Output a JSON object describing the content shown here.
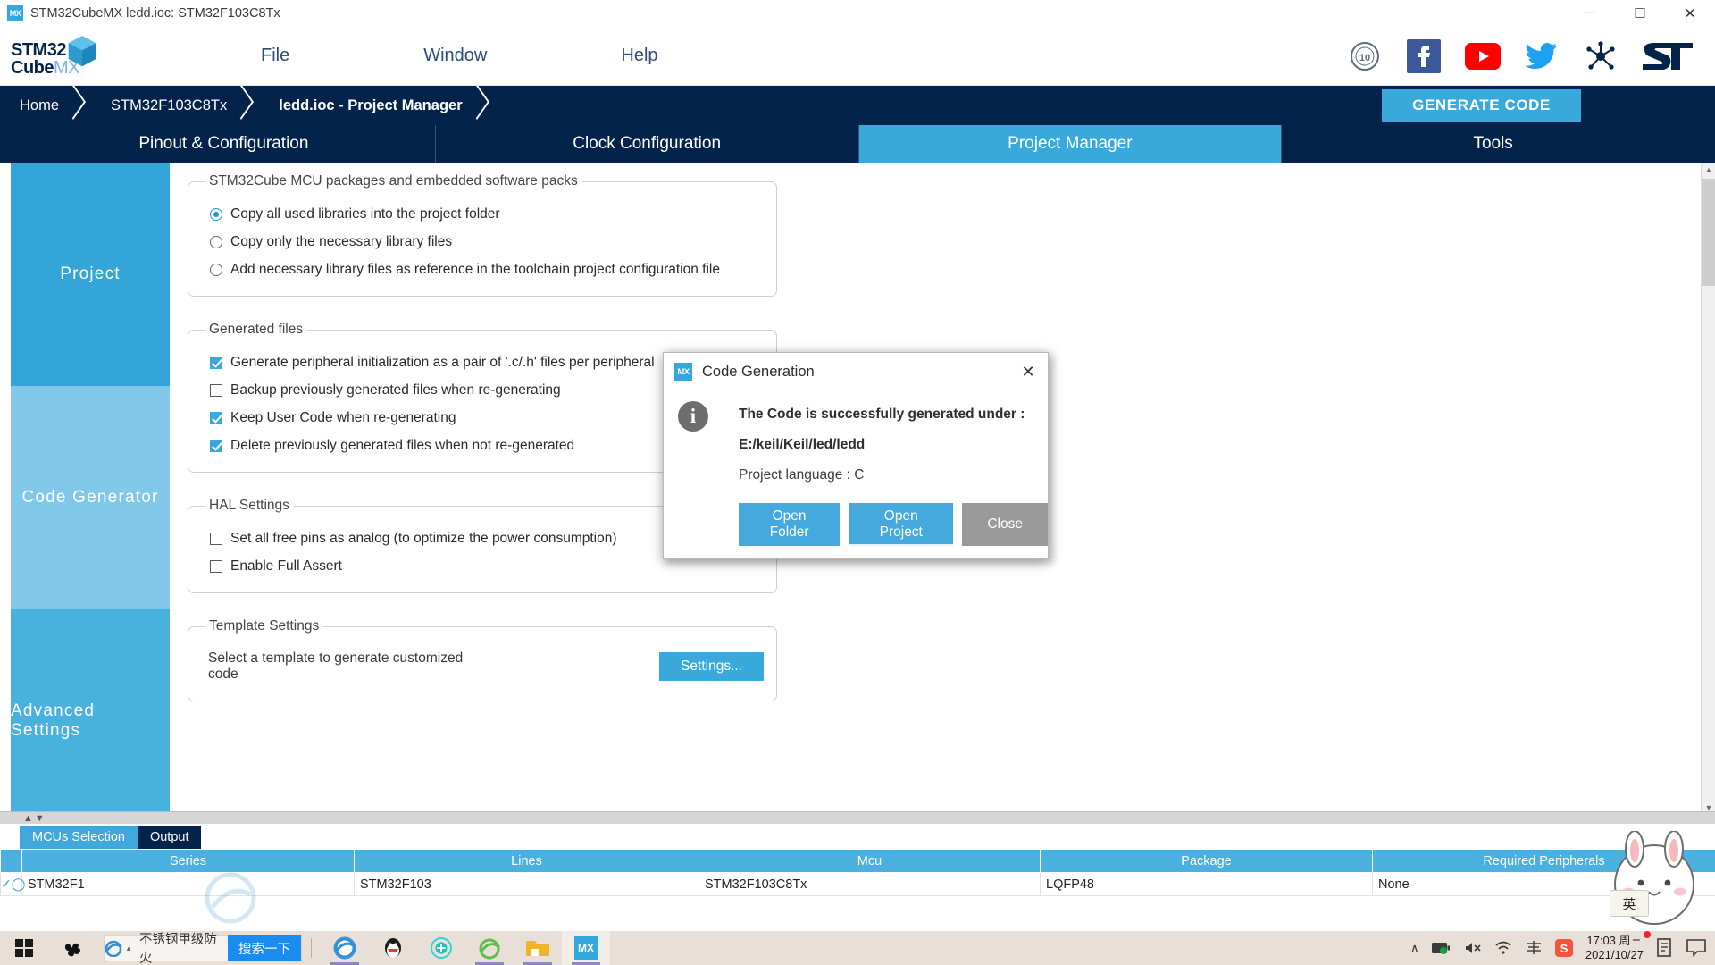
{
  "window": {
    "title": "STM32CubeMX ledd.ioc: STM32F103C8Tx",
    "app_icon": "MX",
    "minimize": "─",
    "maximize": "☐",
    "close": "✕"
  },
  "header": {
    "logo_line1": "STM32",
    "logo_line2": "Cube",
    "logo_line2_suffix": "MX",
    "menu": [
      {
        "label": "File"
      },
      {
        "label": "Window"
      },
      {
        "label": "Help"
      }
    ],
    "icons": [
      {
        "name": "ten-years-badge-icon",
        "label": "10"
      },
      {
        "name": "facebook-icon",
        "label": "f"
      },
      {
        "name": "youtube-icon",
        "label": "▶"
      },
      {
        "name": "twitter-icon",
        "label": "🐦"
      },
      {
        "name": "st-community-icon",
        "label": "✳"
      },
      {
        "name": "st-logo-icon",
        "label": "ST"
      }
    ]
  },
  "breadcrumb": {
    "items": [
      {
        "label": "Home",
        "bold": false
      },
      {
        "label": "STM32F103C8Tx",
        "bold": false
      },
      {
        "label": "ledd.ioc - Project Manager",
        "bold": true
      }
    ],
    "generate_code_label": "GENERATE CODE"
  },
  "main_tabs": [
    {
      "label": "Pinout & Configuration",
      "active": false
    },
    {
      "label": "Clock Configuration",
      "active": false
    },
    {
      "label": "Project Manager",
      "active": true
    },
    {
      "label": "Tools",
      "active": false
    }
  ],
  "sidebar": {
    "items": [
      {
        "label": "Project",
        "state": "normal"
      },
      {
        "label": "Code Generator",
        "state": "selected"
      },
      {
        "label": "Advanced Settings",
        "state": "normal"
      }
    ]
  },
  "panel": {
    "packages_group": {
      "legend": "STM32Cube MCU packages and embedded software packs",
      "options": [
        {
          "label": "Copy all used libraries into the project folder",
          "checked": true
        },
        {
          "label": "Copy only the necessary library files",
          "checked": false
        },
        {
          "label": "Add necessary library files as reference in the toolchain project configuration file",
          "checked": false
        }
      ]
    },
    "generated_files_group": {
      "legend": "Generated files",
      "options": [
        {
          "label": "Generate peripheral initialization as a pair of '.c/.h' files per peripheral",
          "checked": true
        },
        {
          "label": "Backup previously generated files when re-generating",
          "checked": false
        },
        {
          "label": "Keep User Code when re-generating",
          "checked": true
        },
        {
          "label": "Delete previously generated files when not re-generated",
          "checked": true
        }
      ]
    },
    "hal_settings_group": {
      "legend": "HAL Settings",
      "options": [
        {
          "label": "Set all free pins as analog (to optimize the power consumption)",
          "checked": false
        },
        {
          "label": "Enable Full Assert",
          "checked": false
        }
      ]
    },
    "template_settings_group": {
      "legend": "Template Settings",
      "description": "Select a template to generate customized code",
      "settings_button": "Settings..."
    }
  },
  "dialog": {
    "icon": "MX",
    "title": "Code Generation",
    "close_label": "✕",
    "info_glyph": "i",
    "message_line1": "The Code is successfully generated under :",
    "message_line2": "E:/keil/Keil/led/ledd",
    "message_line3": "Project language : C",
    "buttons": [
      {
        "label": "Open Folder",
        "style": "blue"
      },
      {
        "label": "Open Project",
        "style": "blue-focus"
      },
      {
        "label": "Close",
        "style": "gray"
      }
    ]
  },
  "bottom_pane": {
    "tabs": [
      {
        "label": "MCUs Selection",
        "active": true
      },
      {
        "label": "Output",
        "active": false
      }
    ],
    "table": {
      "columns": [
        "",
        "Series",
        "Lines",
        "Mcu",
        "Package",
        "Required Peripherals"
      ],
      "rows": [
        {
          "selected": true,
          "series": "STM32F1",
          "lines": "STM32F103",
          "mcu": "STM32F103C8Tx",
          "package": "LQFP48",
          "required_peripherals": "None"
        }
      ]
    }
  },
  "taskbar": {
    "start_icon": "start-icon",
    "second_icon": "pinwheel-icon",
    "search": {
      "engine_icon": "ie-icon",
      "value": "不锈钢甲级防火",
      "button_label": "搜索一下"
    },
    "apps": [
      {
        "name": "edge-icon",
        "label": "e",
        "running": true
      },
      {
        "name": "qq-icon",
        "label": "Q",
        "running": false
      },
      {
        "name": "security-icon",
        "label": "⊕",
        "running": false
      },
      {
        "name": "ie-icon",
        "label": "e",
        "running": true
      },
      {
        "name": "file-explorer-icon",
        "label": "📁",
        "running": true
      },
      {
        "name": "stm32cubemx-icon",
        "label": "MX",
        "running": true
      }
    ],
    "tray": [
      {
        "name": "show-hidden-icons",
        "label": "∧"
      },
      {
        "name": "battery-icon",
        "label": "🔋"
      },
      {
        "name": "volume-muted-icon",
        "label": "🔇"
      },
      {
        "name": "wifi-icon",
        "label": "📶"
      },
      {
        "name": "ime-toolbar-icon",
        "label": "蓝"
      },
      {
        "name": "sogou-icon",
        "label": "S"
      }
    ],
    "clock_time": "17:03 周三",
    "clock_date": "2021/10/27",
    "notes_icon": "notes-icon",
    "action-center": "action-center-icon"
  },
  "overlay": {
    "ime_badge": "英"
  }
}
